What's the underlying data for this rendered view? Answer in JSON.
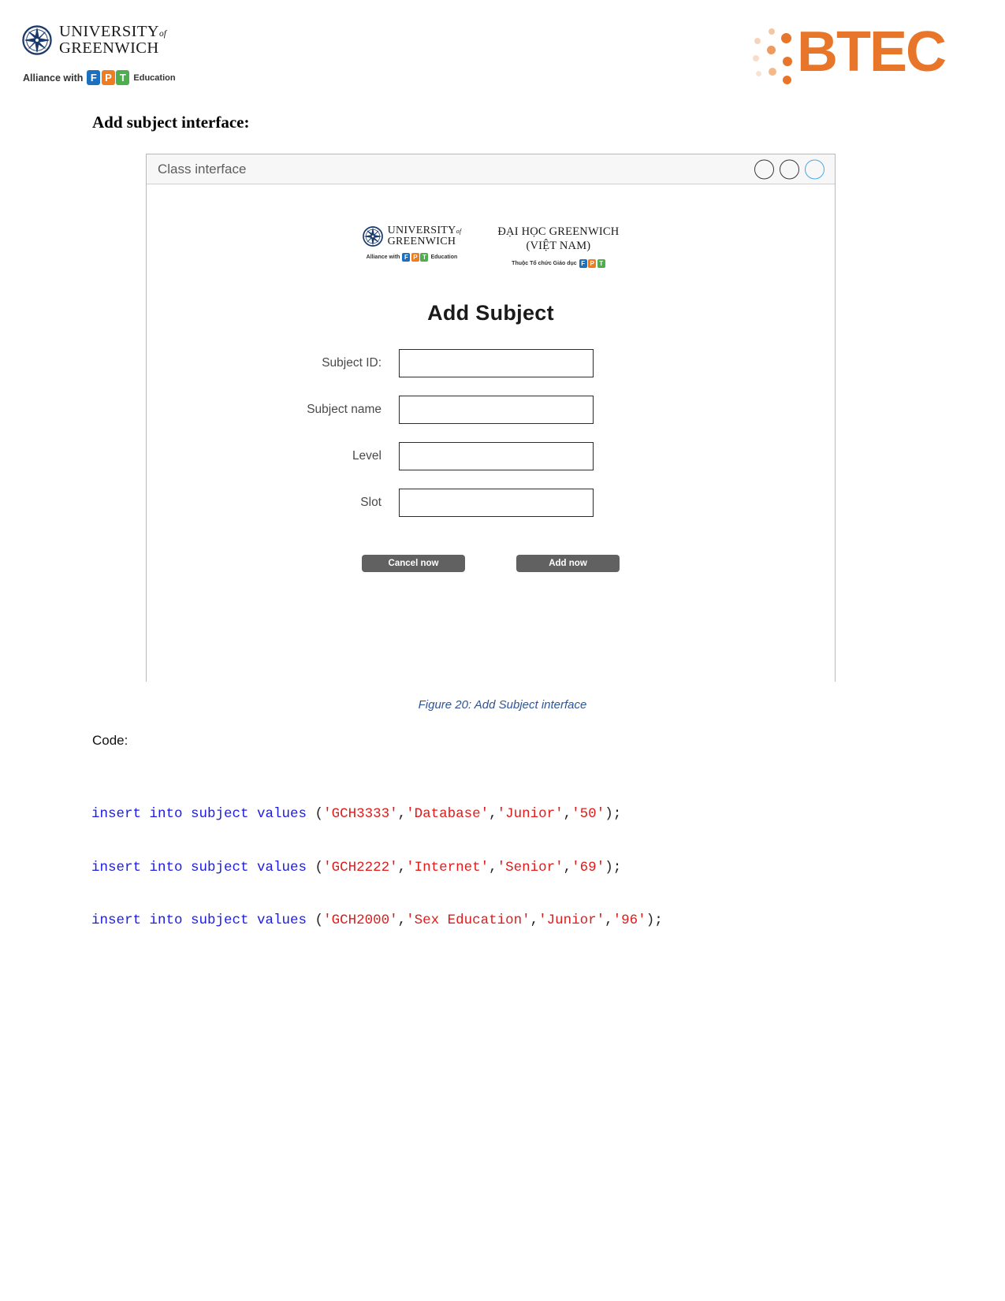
{
  "header": {
    "university": {
      "line1": "UNIVERSITY",
      "of": "of",
      "line2": "GREENWICH",
      "alliance_prefix": "Alliance with",
      "alliance_suffix": "Education",
      "fpt_letters": [
        "F",
        "P",
        "T"
      ]
    },
    "btec": {
      "wordmark": "BTEC",
      "color": "#e8762a"
    }
  },
  "section": {
    "title": "Add subject interface:"
  },
  "window": {
    "titlebar": {
      "title": "Class interface",
      "controls": [
        {
          "name": "minimize-circle",
          "color": "#3a3a3a"
        },
        {
          "name": "maximize-circle",
          "color": "#3a3a3a"
        },
        {
          "name": "close-circle",
          "color": "#4aa8e8"
        }
      ]
    },
    "logos": {
      "uog_line1": "UNIVERSITY",
      "uog_of": "of",
      "uog_line2": "GREENWICH",
      "uog_sub_prefix": "Alliance with",
      "uog_sub_suffix": "Education",
      "vn_line1": "ĐẠI HỌC GREENWICH",
      "vn_line2": "(VIỆT NAM)",
      "vn_sub": "Thuộc Tổ chức Giáo dục",
      "fpt_letters": [
        "F",
        "P",
        "T"
      ]
    },
    "form": {
      "title": "Add Subject",
      "fields": [
        {
          "label": "Subject ID:",
          "value": "",
          "placeholder": ""
        },
        {
          "label": "Subject name",
          "value": "",
          "placeholder": ""
        },
        {
          "label": "Level",
          "value": "",
          "placeholder": ""
        },
        {
          "label": "Slot",
          "value": "",
          "placeholder": ""
        }
      ],
      "buttons": {
        "cancel": "Cancel now",
        "add": "Add now"
      }
    }
  },
  "caption": "Figure 20: Add Subject interface",
  "code": {
    "label": "Code:",
    "lines": [
      {
        "keyword": "insert into subject values",
        "open": " (",
        "args": [
          "'GCH3333'",
          "'Database'",
          "'Junior'",
          "'50'"
        ],
        "close": ");"
      },
      {
        "keyword": "insert into subject values",
        "open": " (",
        "args": [
          "'GCH2222'",
          "'Internet'",
          "'Senior'",
          "'69'"
        ],
        "close": ");"
      },
      {
        "keyword": "insert into subject values",
        "open": " (",
        "args": [
          "'GCH2000'",
          "'Sex Education'",
          "'Junior'",
          "'96'"
        ],
        "close": ");"
      }
    ],
    "keyword_color": "#1c1ce0",
    "string_color": "#e01b1b"
  }
}
